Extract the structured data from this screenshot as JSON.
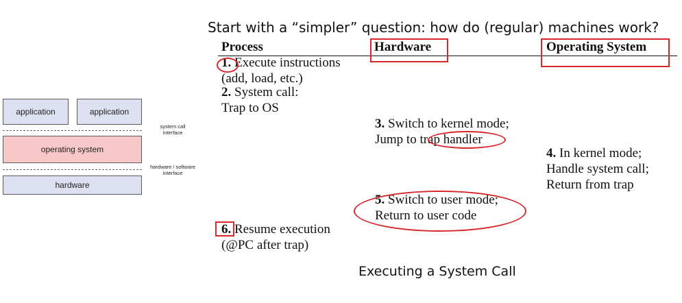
{
  "layers": {
    "app_left": "application",
    "app_right": "application",
    "os": "operating system",
    "hardware": "hardware",
    "syscall_interface": "system call\ninterface",
    "hw_sw_interface": "hardware / software\ninterface"
  },
  "colors": {
    "layer_fill": "#dde0f0",
    "os_fill": "#f8c8c8",
    "highlight": "#d9262b"
  },
  "title": "Start with a “simpler” question: how do (regular) machines work?",
  "columns": {
    "process": "Process",
    "hardware": "Hardware",
    "os": "Operating System"
  },
  "steps": {
    "s1_num": "1.",
    "s1_line1": " Execute instructions",
    "s1_line2": "(add, load, etc.)",
    "s2_num": "2.",
    "s2_line1": " System call:",
    "s2_line2": "Trap to OS",
    "s3_num": "3.",
    "s3_line1": " Switch to kernel mode;",
    "s3_line2": "Jump to trap handler",
    "s4_num": "4.",
    "s4_line1": " In kernel mode;",
    "s4_line2": "Handle system call;",
    "s4_line3": "Return from trap",
    "s5_num": "5.",
    "s5_line1": " Switch to user mode;",
    "s5_line2": "Return to user code",
    "s6_num": "6.",
    "s6_line1": " Resume execution",
    "s6_line2": "(@PC after trap)"
  },
  "caption": "Executing a System Call"
}
